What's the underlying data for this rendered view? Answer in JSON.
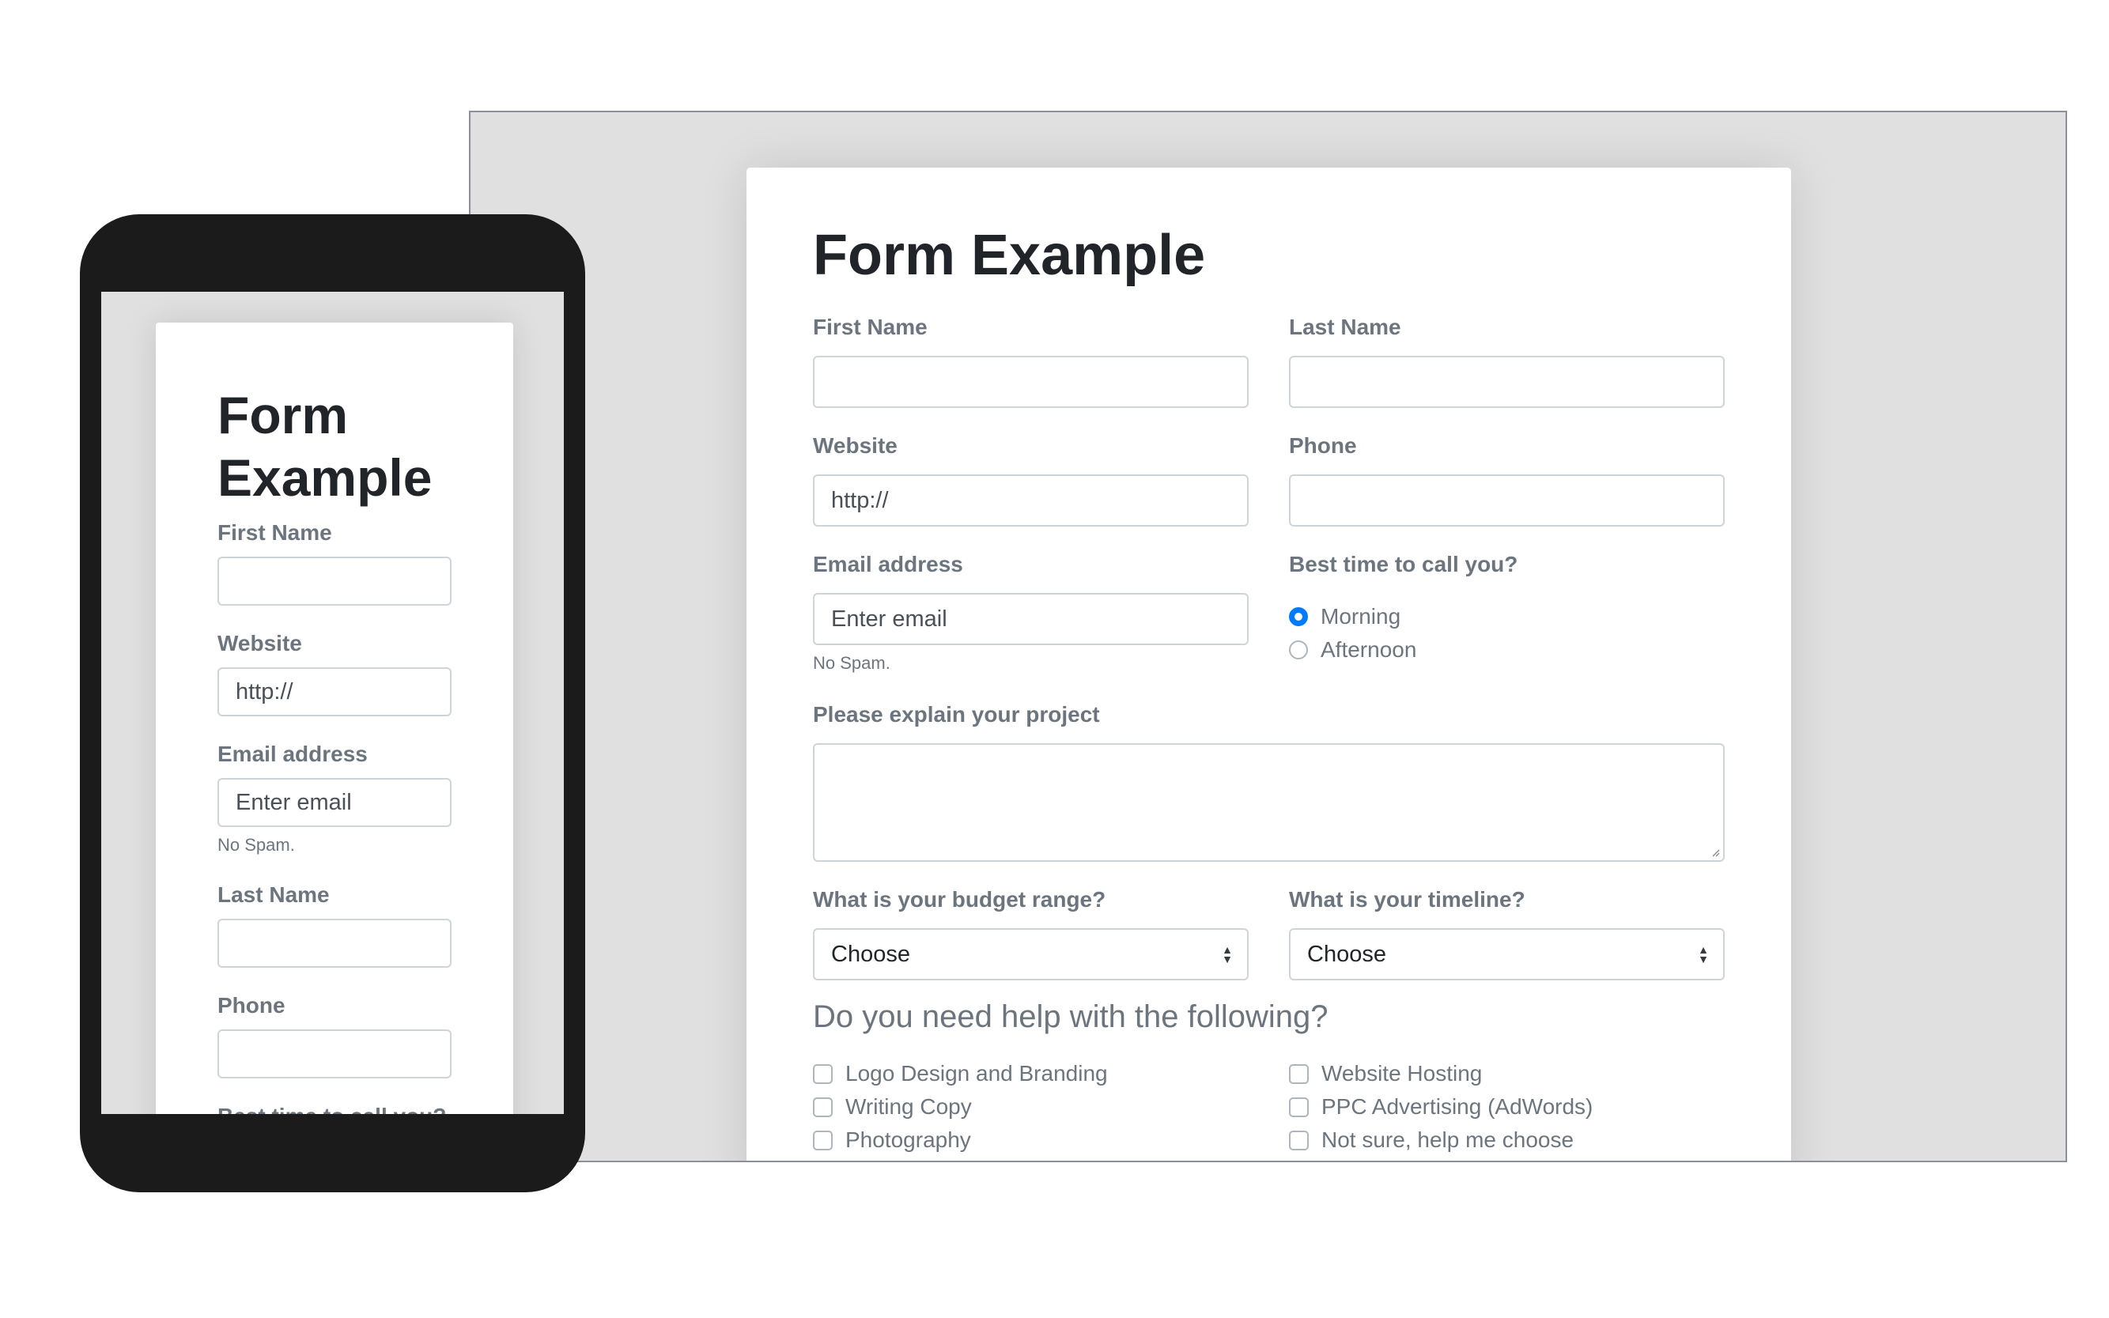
{
  "desktop": {
    "title": "Form Example",
    "fields": {
      "first_name": {
        "label": "First Name",
        "value": "",
        "placeholder": ""
      },
      "last_name": {
        "label": "Last Name",
        "value": "",
        "placeholder": ""
      },
      "website": {
        "label": "Website",
        "value": "",
        "placeholder": "http://"
      },
      "phone": {
        "label": "Phone",
        "value": "",
        "placeholder": ""
      },
      "email": {
        "label": "Email address",
        "value": "",
        "placeholder": "Enter email",
        "help": "No Spam."
      },
      "call_time": {
        "label": "Best time to call you?",
        "options": [
          {
            "label": "Morning",
            "checked": true
          },
          {
            "label": "Afternoon",
            "checked": false
          }
        ]
      },
      "project": {
        "label": "Please explain your project",
        "value": ""
      },
      "budget": {
        "label": "What is your budget range?",
        "selected": "Choose"
      },
      "timeline": {
        "label": "What is your timeline?",
        "selected": "Choose"
      }
    },
    "help_heading": "Do you need help with the following?",
    "help_options": [
      {
        "label": "Logo Design and Branding",
        "checked": false
      },
      {
        "label": "Writing Copy",
        "checked": false
      },
      {
        "label": "Photography",
        "checked": false
      },
      {
        "label": "Website Hosting",
        "checked": false
      },
      {
        "label": "PPC Advertising (AdWords)",
        "checked": false
      },
      {
        "label": "Not sure, help me choose",
        "checked": false
      }
    ]
  },
  "mobile": {
    "title_line1": "Form",
    "title_line2": "Example",
    "first_name_label": "First Name",
    "website_label": "Website",
    "website_placeholder": "http://",
    "email_label": "Email address",
    "email_placeholder": "Enter email",
    "email_help": "No Spam.",
    "last_name_label": "Last Name",
    "phone_label": "Phone",
    "next_label": "Best time to call you?"
  },
  "colors": {
    "accent": "#007bff",
    "label": "#6c757d",
    "heading": "#212529",
    "border": "#ced4da",
    "frame": "#1b1b1b",
    "backdrop": "#e0e0e0"
  }
}
